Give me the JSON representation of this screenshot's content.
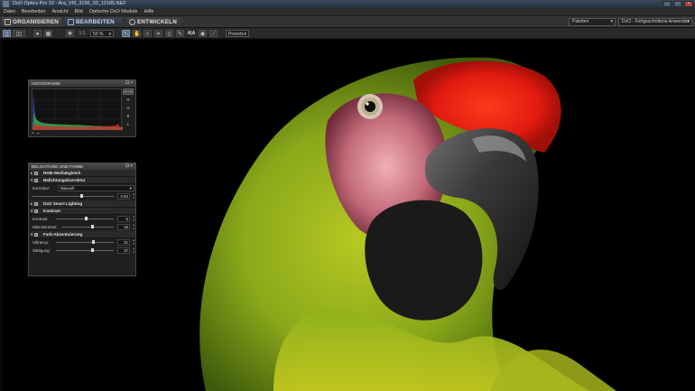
{
  "window": {
    "title": "DxO Optics Pro 10 - Ara_VIII_3196_00_12185.NEF"
  },
  "menu": [
    "Datei",
    "Bearbeiten",
    "Ansicht",
    "Bild",
    "Optische DxO Module",
    "Hilfe"
  ],
  "tabs": [
    {
      "label": "ORGANISIEREN"
    },
    {
      "label": "BEARBEITEN"
    },
    {
      "label": "ENTWICKELN"
    }
  ],
  "header_right": {
    "palettes_label": "Paletten",
    "preset_label": "DxO - Fortgeschrittene Anwender"
  },
  "toolbar": {
    "zoom_fit": "1:1",
    "zoom_value": "50 %",
    "ab_label": "A|A",
    "presets_label": "Presets"
  },
  "histogram": {
    "title": "HISTOGRAMM",
    "channels": [
      "RGB",
      "R",
      "G",
      "B",
      "L"
    ]
  },
  "lighting": {
    "title": "BELICHTUNG UND FARBE",
    "sections": {
      "white_balance": "RGB-Weißabgleich",
      "exposure": "Belichtungskorrektur",
      "smart_lighting": "DxO Smart Lighting",
      "contrast": "Kontrast",
      "color": "Farb-Akzentuierung"
    },
    "exposure_correction": {
      "label": "Korrektur:",
      "mode": "Manuell",
      "value": "0.83",
      "fraction": 0.6
    },
    "contrast": {
      "label": "Kontrast:",
      "value": "6",
      "fraction": 0.53
    },
    "micro_contrast": {
      "label": "Mikrokontrast:",
      "value": "18",
      "fraction": 0.59
    },
    "vibrancy": {
      "label": "Vibrancy:",
      "value": "31",
      "fraction": 0.65
    },
    "saturation": {
      "label": "Sättigung:",
      "value": "27",
      "fraction": 0.63
    }
  }
}
